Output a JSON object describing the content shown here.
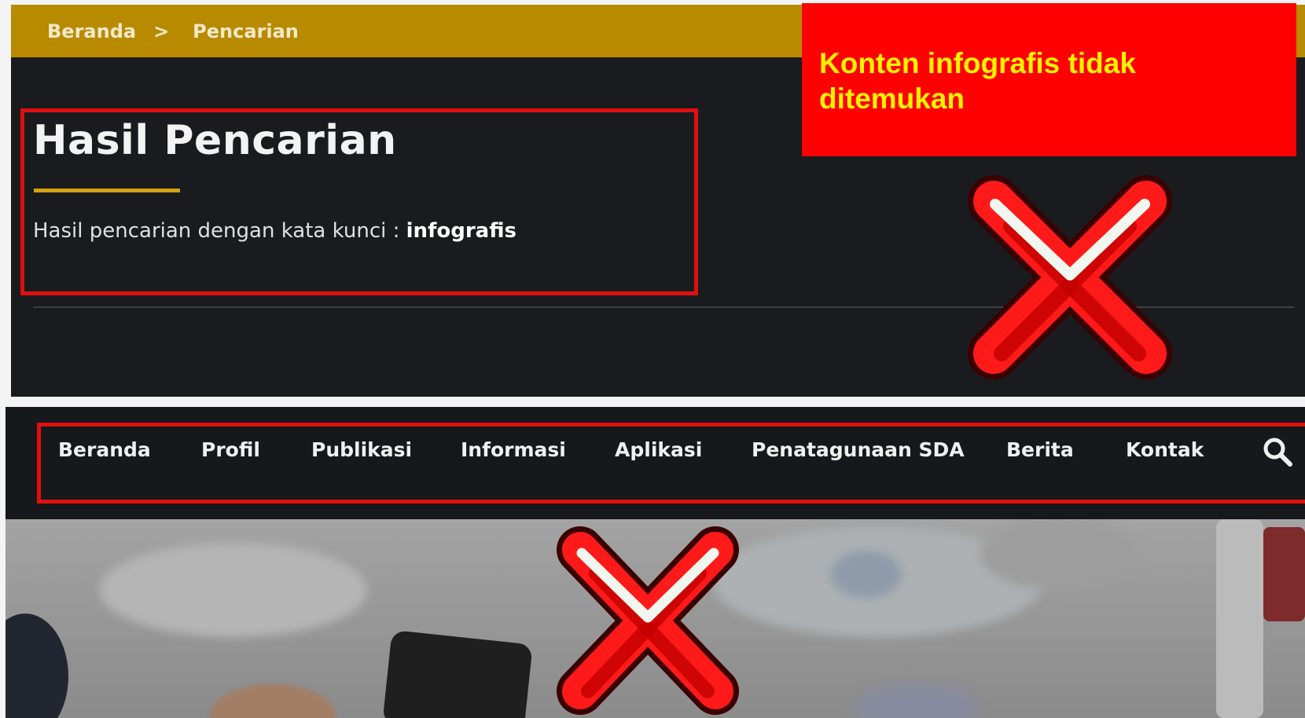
{
  "breadcrumb": {
    "items": [
      "Beranda",
      "Pencarian"
    ],
    "separator": ">"
  },
  "page": {
    "title": "Hasil Pencarian",
    "result_prefix": "Hasil pencarian dengan kata kunci :",
    "keyword": "infografis"
  },
  "notice": {
    "text": "Konten infografis tidak ditemukan"
  },
  "nav": {
    "items": [
      "Beranda",
      "Profil",
      "Publikasi",
      "Informasi",
      "Aplikasi",
      "Penatagunaan SDA",
      "Berita",
      "Kontak"
    ],
    "search_icon": "search-icon"
  },
  "marks": {
    "error_icon": "red-x-icon"
  },
  "colors": {
    "breadcrumb_bar": "#b88a00",
    "page_background": "#1a1b1e",
    "accent_underline": "#d3a114",
    "highlight_border": "#e10f0f",
    "notice_background": "#ff0000",
    "notice_text": "#fff200"
  }
}
